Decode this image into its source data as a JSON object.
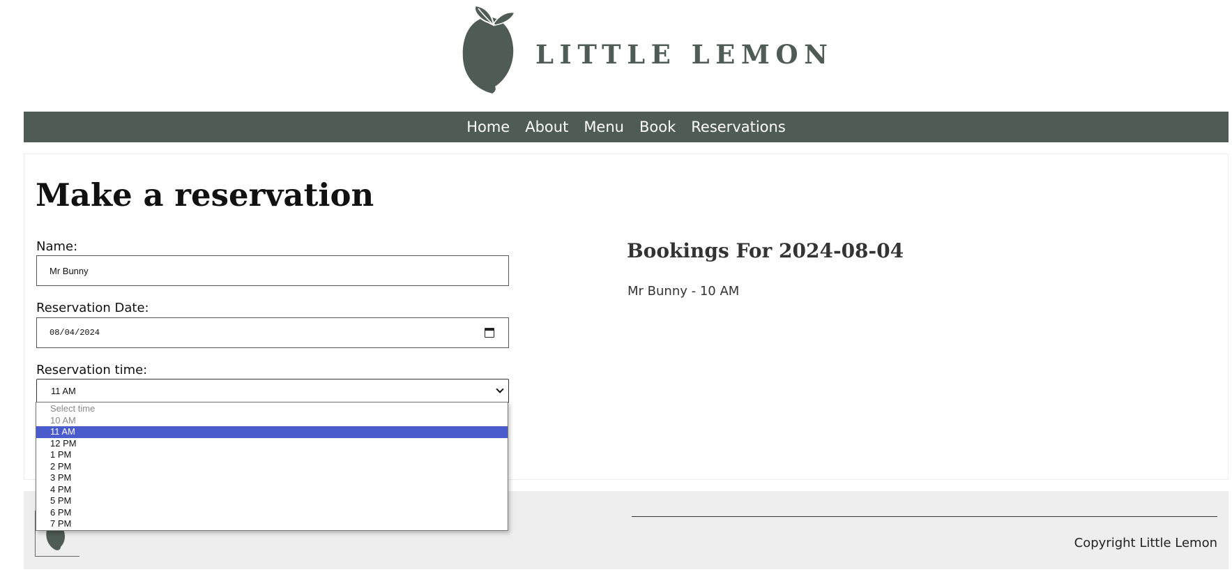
{
  "brand": {
    "name": "LITTLE LEMON",
    "color": "#4f5b55"
  },
  "nav": {
    "items": [
      {
        "label": "Home"
      },
      {
        "label": "About"
      },
      {
        "label": "Menu"
      },
      {
        "label": "Book"
      },
      {
        "label": "Reservations"
      }
    ]
  },
  "form": {
    "title": "Make a reservation",
    "name_label": "Name:",
    "name_value": "Mr Bunny",
    "date_label": "Reservation Date:",
    "date_value": "08/04/2024",
    "date_icon": "calendar-icon",
    "time_label": "Reservation time:",
    "time_value": "11 AM",
    "time_icon": "chevron-down-icon",
    "time_options": [
      {
        "label": "Select time",
        "disabled": true,
        "selected": false
      },
      {
        "label": "10 AM",
        "disabled": true,
        "selected": false
      },
      {
        "label": "11 AM",
        "disabled": false,
        "selected": true
      },
      {
        "label": "12 PM",
        "disabled": false,
        "selected": false
      },
      {
        "label": "1 PM",
        "disabled": false,
        "selected": false
      },
      {
        "label": "2 PM",
        "disabled": false,
        "selected": false
      },
      {
        "label": "3 PM",
        "disabled": false,
        "selected": false
      },
      {
        "label": "4 PM",
        "disabled": false,
        "selected": false
      },
      {
        "label": "5 PM",
        "disabled": false,
        "selected": false
      },
      {
        "label": "6 PM",
        "disabled": false,
        "selected": false
      },
      {
        "label": "7 PM",
        "disabled": false,
        "selected": false
      }
    ],
    "highlight_color": "#4a5bcc"
  },
  "bookings": {
    "title": "Bookings For 2024-08-04",
    "items": [
      "Mr Bunny - 10 AM"
    ]
  },
  "footer": {
    "copyright": "Copyright Little Lemon",
    "background": "#eeeeee"
  }
}
